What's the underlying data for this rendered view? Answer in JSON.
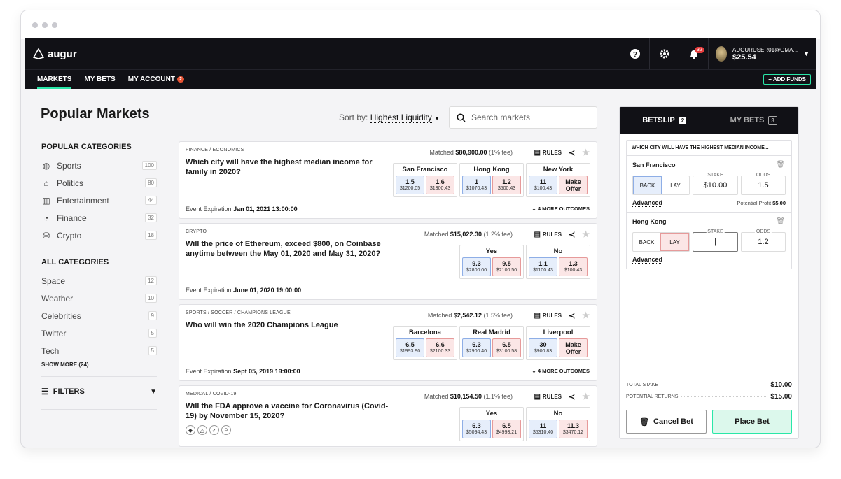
{
  "topbar": {
    "logo_text": "augur",
    "notifications_count": "32",
    "account_email": "AUGURUSER01@GMA...",
    "account_balance": "$25.54"
  },
  "nav": {
    "items": [
      {
        "label": "MARKETS"
      },
      {
        "label": "MY BETS"
      },
      {
        "label": "MY ACCOUNT",
        "badge": "2"
      }
    ],
    "add_funds": "+ ADD FUNDS"
  },
  "page": {
    "title": "Popular Markets",
    "sort_label": "Sort by:",
    "sort_value": "Highest Liquidity",
    "search_placeholder": "Search markets"
  },
  "sidebar": {
    "popular_heading": "POPULAR CATEGORIES",
    "popular": [
      {
        "label": "Sports",
        "count": "100",
        "icon": "sports-globe-icon"
      },
      {
        "label": "Politics",
        "count": "80",
        "icon": "politics-building-icon"
      },
      {
        "label": "Entertainment",
        "count": "44",
        "icon": "entertainment-popcorn-icon"
      },
      {
        "label": "Finance",
        "count": "32",
        "icon": "finance-chart-icon"
      },
      {
        "label": "Crypto",
        "count": "18",
        "icon": "crypto-coins-icon"
      }
    ],
    "all_heading": "ALL CATEGORIES",
    "all": [
      {
        "label": "Space",
        "count": "12"
      },
      {
        "label": "Weather",
        "count": "10"
      },
      {
        "label": "Celebrities",
        "count": "9"
      },
      {
        "label": "Twitter",
        "count": "5"
      },
      {
        "label": "Tech",
        "count": "5"
      }
    ],
    "show_more": "SHOW MORE (24)",
    "filters": "FILTERS"
  },
  "markets": [
    {
      "category": "FINANCE / ECONOMICS",
      "matched_label": "Matched",
      "matched_value": "$80,900.00",
      "fee": "(1% fee)",
      "question": "Which city will have the highest median income for family in 2020?",
      "expiration_label": "Event Expiration",
      "expiration": "Jan 01, 2021 13:00:00",
      "more": "4 MORE OUTCOMES",
      "outcomes": [
        {
          "name": "San Francisco",
          "back_price": "1.5",
          "back_vol": "$1200.05",
          "lay_price": "1.6",
          "lay_vol": "$1300.43"
        },
        {
          "name": "Hong Kong",
          "back_price": "1",
          "back_vol": "$1070.43",
          "lay_price": "1.2",
          "lay_vol": "$500.43"
        },
        {
          "name": "New York",
          "back_price": "11",
          "back_vol": "$100.43",
          "lay_price": "Make Offer",
          "lay_vol": ""
        }
      ]
    },
    {
      "category": "CRYPTO",
      "matched_label": "Matched",
      "matched_value": "$15,022.30",
      "fee": "(1.2% fee)",
      "question": "Will the price of Ethereum, exceed $800, on Coinbase anytime between the May 01, 2020 and May 31, 2020?",
      "expiration_label": "Event Expiration",
      "expiration": "June 01, 2020 19:00:00",
      "more": "",
      "outcomes": [
        {
          "name": "Yes",
          "back_price": "9.3",
          "back_vol": "$2800.00",
          "lay_price": "9.5",
          "lay_vol": "$2100.50"
        },
        {
          "name": "No",
          "back_price": "1.1",
          "back_vol": "$1100.43",
          "lay_price": "1.3",
          "lay_vol": "$100.43"
        }
      ]
    },
    {
      "category": "SPORTS / SOCCER / CHAMPIONS LEAGUE",
      "matched_label": "Matched",
      "matched_value": "$2,542.12",
      "fee": "(1.5% fee)",
      "question": "Who will win the 2020 Champions League",
      "expiration_label": "Event Expiration",
      "expiration": "Sept 05, 2019 19:00:00",
      "more": "4 MORE OUTCOMES",
      "outcomes": [
        {
          "name": "Barcelona",
          "back_price": "6.5",
          "back_vol": "$1993.90",
          "lay_price": "6.6",
          "lay_vol": "$2100.33"
        },
        {
          "name": "Real Madrid",
          "back_price": "6.3",
          "back_vol": "$2900.40",
          "lay_price": "6.5",
          "lay_vol": "$3100.58"
        },
        {
          "name": "Liverpool",
          "back_price": "30",
          "back_vol": "$900.83",
          "lay_price": "Make Offer",
          "lay_vol": ""
        }
      ]
    },
    {
      "category": "MEDICAL / COVID-19",
      "matched_label": "Matched",
      "matched_value": "$10,154.50",
      "fee": "(1.1% fee)",
      "question": "Will the FDA approve a vaccine for Coronavirus (Covid-19) by November 15, 2020?",
      "expiration_label": "",
      "expiration": "",
      "more": "",
      "outcomes": [
        {
          "name": "Yes",
          "back_price": "6.3",
          "back_vol": "$5094.43",
          "lay_price": "6.5",
          "lay_vol": "$4993.21"
        },
        {
          "name": "No",
          "back_price": "11",
          "back_vol": "$5310.40",
          "lay_price": "11.3",
          "lay_vol": "$3470.12"
        }
      ]
    }
  ],
  "rules_label": "RULES",
  "betslip": {
    "tab_betslip": "BETSLIP",
    "tab_betslip_count": "2",
    "tab_mybets": "MY BETS",
    "tab_mybets_count": "3",
    "group_title": "WHICH CITY WILL HAVE THE HIGHEST MEDIAN INCOME...",
    "back_label": "BACK",
    "lay_label": "LAY",
    "stake_label": "STAKE",
    "odds_label": "ODDS",
    "advanced": "Advanced",
    "bets": [
      {
        "name": "San Francisco",
        "side": "back",
        "stake": "$10.00",
        "odds": "1.5",
        "profit_label": "Potential Profit",
        "profit": "$5.00"
      },
      {
        "name": "Hong Kong",
        "side": "lay",
        "stake": "",
        "odds": "1.2",
        "profit_label": "",
        "profit": ""
      }
    ],
    "total_stake_label": "TOTAL STAKE",
    "total_stake": "$10.00",
    "potential_returns_label": "POTENTIAL RETURNS",
    "potential_returns": "$15.00",
    "cancel": "Cancel Bet",
    "place": "Place Bet"
  }
}
